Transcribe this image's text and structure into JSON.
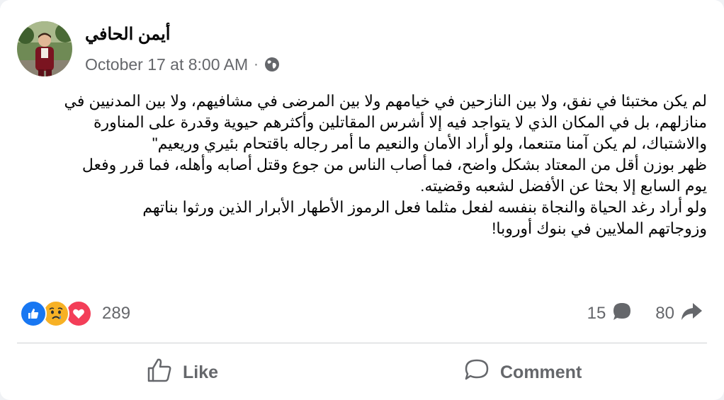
{
  "post": {
    "author": "أيمن الحافي",
    "timestamp": "October 17 at 8:00 AM",
    "separator": "·",
    "audience_icon": "globe-icon",
    "body_lines": [
      "لم يكن مختبئا في نفق، ولا بين النازحين في خيامهم ولا بين المرضى في مشافيهم، ولا بين المدنيين في",
      "منازلهم،  بل في المكان الذي لا يتواجد فيه إلا أشرس المقاتلين وأكثرهم حيوية وقدرة على المناورة",
      "والاشتباك، لم يكن آمنا متنعما، ولو أراد الأمان والنعيم ما أمر رجاله باقتحام  بئيري وريعيم\"",
      "ظهر بوزن أقل من المعتاد بشكل واضح، فما أصاب الناس من جوع وقتل أصابه وأهله، فما قرر وفعل",
      "يوم السابع إلا بحثا عن الأفضل لشعبه وقضيته.",
      "ولو أراد رغد الحياة والنجاة بنفسه لفعل مثلما فعل الرموز الأطهار الأبرار الذين ورثوا بناتهم",
      "وزوجاتهم الملايين في بنوك أوروبا!"
    ]
  },
  "engagement": {
    "reaction_icons": [
      "like-icon",
      "sad-icon",
      "love-icon"
    ],
    "reaction_count": "289",
    "comment_count": "15",
    "share_count": "80"
  },
  "actions": {
    "like_label": "Like",
    "comment_label": "Comment"
  },
  "colors": {
    "like_blue": "#1877f2",
    "love_red": "#f33e58",
    "sad_yellow": "#f7b125",
    "secondary_text": "#65676b"
  }
}
